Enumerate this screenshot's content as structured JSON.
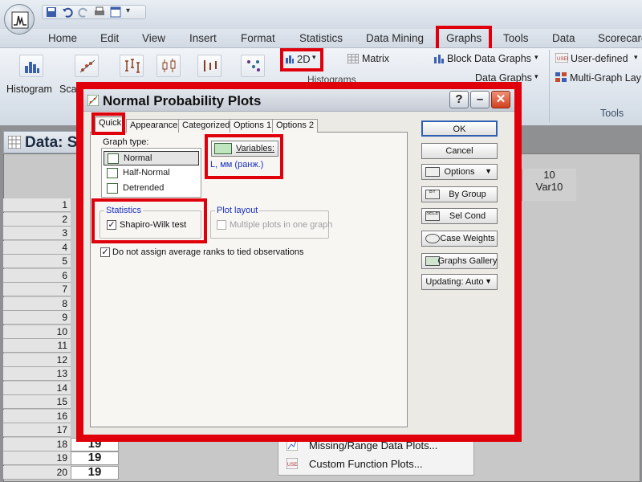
{
  "app": {
    "menu_tabs": [
      "Home",
      "Edit",
      "View",
      "Insert",
      "Format",
      "Statistics",
      "Data Mining",
      "Graphs",
      "Tools",
      "Data",
      "Scorecard"
    ]
  },
  "ribbon": {
    "histogram_label": "Histogram",
    "scatter_label": "Sca",
    "twod_label": "2D",
    "matrix_label": "Matrix",
    "block_data_graphs_label": "Block Data Graphs",
    "data_graphs_label": "Data Graphs",
    "user_defined_label": "User-defined",
    "multi_graph_label": "Multi-Graph Lay",
    "tools_group_label": "Tools",
    "histograms_label": "Histograms"
  },
  "spreadsheet": {
    "title": "Data: S",
    "row_numbers": [
      "1",
      "2",
      "3",
      "4",
      "5",
      "6",
      "7",
      "8",
      "9",
      "10",
      "11",
      "12",
      "13",
      "14",
      "15",
      "16",
      "17",
      "18",
      "19",
      "20"
    ],
    "visible_cells": [
      "19",
      "19",
      "19"
    ],
    "var10_index": "10",
    "var10_name": "Var10"
  },
  "popup_menu": {
    "items": [
      "Missing/Range Data Plots...",
      "Custom Function Plots..."
    ]
  },
  "dialog": {
    "title": "Normal Probability Plots",
    "help_glyph": "?",
    "minimize_glyph": "–",
    "close_glyph": "✕",
    "tabs": [
      "Quick",
      "Appearance",
      "Categorized",
      "Options 1",
      "Options 2"
    ],
    "graph_type_label": "Graph type:",
    "graph_types": [
      "Normal",
      "Half-Normal",
      "Detrended"
    ],
    "variables_button": "Variables:",
    "variables_value": "L, мм (ранж.)",
    "statistics_group": "Statistics",
    "shapiro_label": "Shapiro-Wilk test",
    "plot_layout_group": "Plot layout",
    "multiple_plots_label": "Multiple plots in one graph",
    "tied_obs_label": "Do not assign average ranks to tied observations",
    "check_mark": "✓",
    "buttons": {
      "ok": "OK",
      "cancel": "Cancel",
      "options": "Options",
      "by_group": "By Group",
      "sel_cond": "Sel Cond",
      "case_weights": "Case Weights",
      "graphs_gallery": "Graphs Gallery",
      "updating": "Updating: Auto"
    },
    "button_icon_text": {
      "sel_cond": "SELECT CASES",
      "by_group": "BY"
    }
  },
  "colors": {
    "highlight_red": "#e0000b",
    "variable_blue": "#1b2fbd"
  }
}
